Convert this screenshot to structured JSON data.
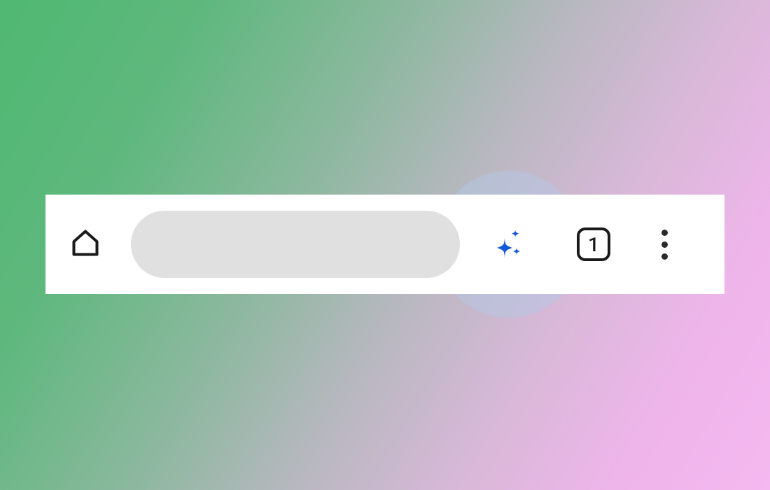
{
  "toolbar": {
    "home_label": "Home",
    "address_value": "",
    "sparkle_label": "AI Assistant",
    "tabs_count": "1",
    "menu_label": "More options"
  },
  "colors": {
    "sparkle": "#1558d6",
    "icon": "#1a1a1a",
    "highlight": "rgba(180, 200, 230, 0.5)"
  },
  "icons": {
    "home": "home-icon",
    "sparkle": "sparkle-icon",
    "tabs": "tabs-icon",
    "menu": "kebab-menu-icon"
  }
}
